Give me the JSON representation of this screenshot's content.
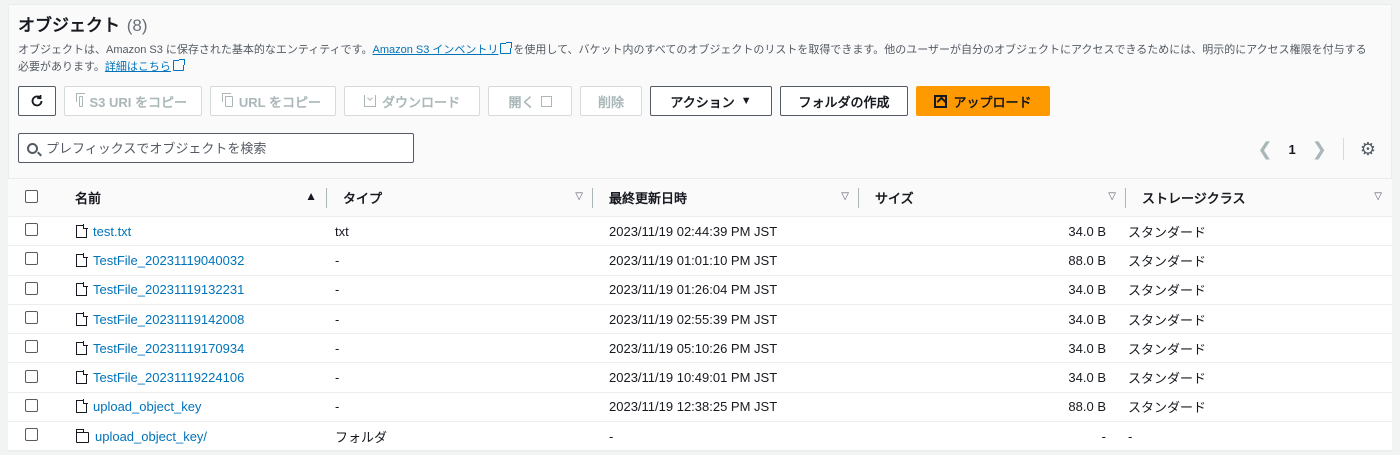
{
  "header": {
    "title": "オブジェクト",
    "count": "(8)",
    "desc_part1": "オブジェクトは、Amazon S3 に保存された基本的なエンティティです。",
    "desc_link1": "Amazon S3 インベントリ",
    "desc_part2": "を使用して、バケット内のすべてのオブジェクトのリストを取得できます。他のユーザーが自分のオブジェクトにアクセスできるためには、明示的にアクセス権限を付与する必要があります。",
    "desc_link2": "詳細はこちら"
  },
  "toolbar": {
    "copy_s3_uri": "S3 URI をコピー",
    "copy_url": "URL をコピー",
    "download": "ダウンロード",
    "open": "開く",
    "delete": "削除",
    "actions": "アクション",
    "create_folder": "フォルダの作成",
    "upload": "アップロード"
  },
  "search": {
    "placeholder": "プレフィックスでオブジェクトを検索"
  },
  "pagination": {
    "page": "1"
  },
  "table": {
    "columns": {
      "name": "名前",
      "type": "タイプ",
      "modified": "最終更新日時",
      "size": "サイズ",
      "storage": "ストレージクラス"
    },
    "rows": [
      {
        "name": "test.txt",
        "type": "txt",
        "modified": "2023/11/19 02:44:39 PM JST",
        "size": "34.0 B",
        "storage": "スタンダード",
        "icon": "file"
      },
      {
        "name": "TestFile_20231119040032",
        "type": "-",
        "modified": "2023/11/19 01:01:10 PM JST",
        "size": "88.0 B",
        "storage": "スタンダード",
        "icon": "file"
      },
      {
        "name": "TestFile_20231119132231",
        "type": "-",
        "modified": "2023/11/19 01:26:04 PM JST",
        "size": "34.0 B",
        "storage": "スタンダード",
        "icon": "file"
      },
      {
        "name": "TestFile_20231119142008",
        "type": "-",
        "modified": "2023/11/19 02:55:39 PM JST",
        "size": "34.0 B",
        "storage": "スタンダード",
        "icon": "file"
      },
      {
        "name": "TestFile_20231119170934",
        "type": "-",
        "modified": "2023/11/19 05:10:26 PM JST",
        "size": "34.0 B",
        "storage": "スタンダード",
        "icon": "file"
      },
      {
        "name": "TestFile_20231119224106",
        "type": "-",
        "modified": "2023/11/19 10:49:01 PM JST",
        "size": "34.0 B",
        "storage": "スタンダード",
        "icon": "file"
      },
      {
        "name": "upload_object_key",
        "type": "-",
        "modified": "2023/11/19 12:38:25 PM JST",
        "size": "88.0 B",
        "storage": "スタンダード",
        "icon": "file"
      },
      {
        "name": "upload_object_key/",
        "type": "フォルダ",
        "modified": "-",
        "size": "-",
        "storage": "-",
        "icon": "folder"
      }
    ]
  },
  "colors": {
    "link": "#0073bb",
    "primary": "#ff9900"
  }
}
